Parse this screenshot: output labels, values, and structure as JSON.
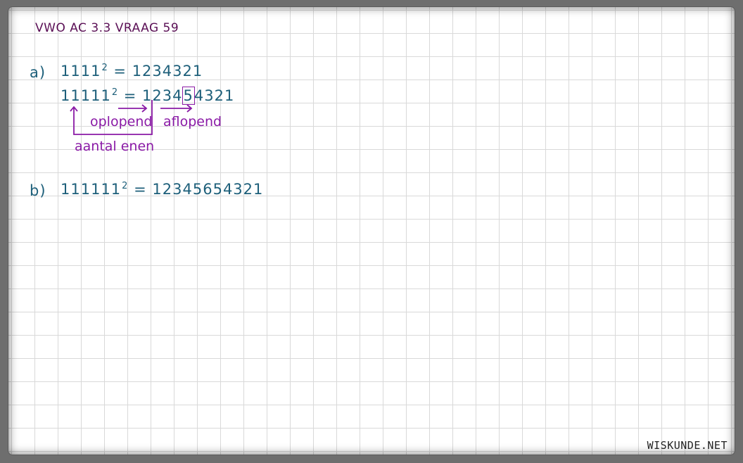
{
  "title": "VWO AC 3.3 VRAAG 59",
  "part_a": {
    "label": "a)",
    "line1": {
      "base": "1111",
      "exp": "2",
      "result": "= 1234321"
    },
    "line2": {
      "base": "11111",
      "exp": "2",
      "result_left": "= 1234",
      "boxed": "5",
      "result_right": "4321"
    },
    "annotation_ascending": "oplopend",
    "annotation_descending": "aflopend",
    "annotation_count": "aantal enen"
  },
  "part_b": {
    "label": "b)",
    "base": "111111",
    "exp": "2",
    "result": "= 12345654321"
  },
  "footer": "WISKUNDE.NET",
  "colors": {
    "title": "#5a0f55",
    "math": "#1d5f7a",
    "annotation": "#8a1aa6"
  }
}
